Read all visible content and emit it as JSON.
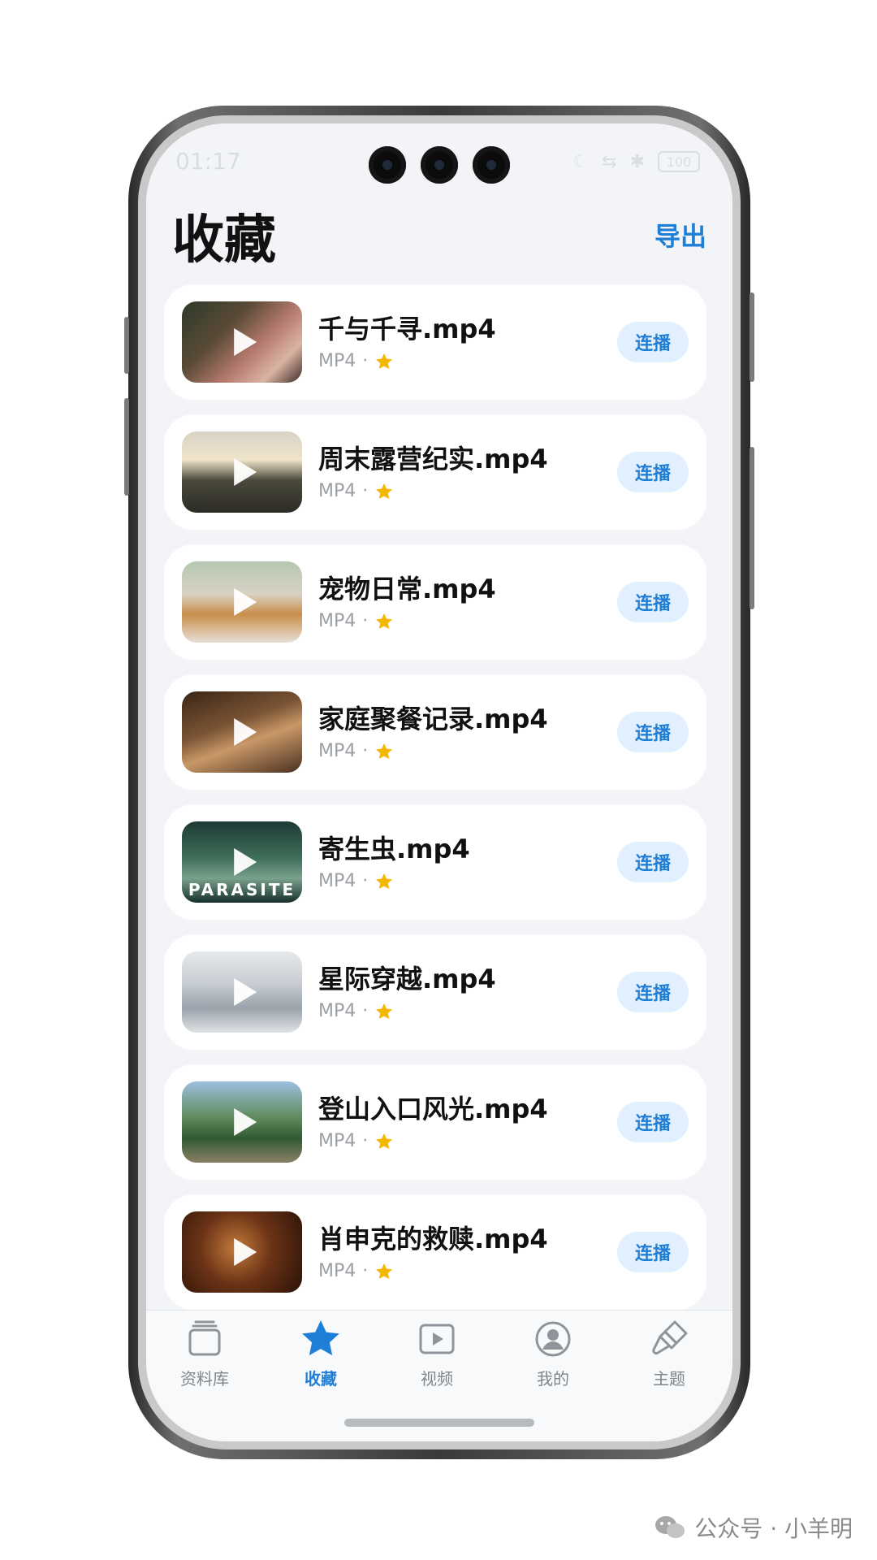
{
  "status_bar": {
    "time": "01:17",
    "battery": "100"
  },
  "header": {
    "title": "收藏",
    "export_label": "导出"
  },
  "items": [
    {
      "name": "千与千寻.mp4",
      "format": "MP4",
      "separator": "·",
      "play_label": "连播",
      "favorite": true,
      "thumb_overlay": ""
    },
    {
      "name": "周末露营纪实.mp4",
      "format": "MP4",
      "separator": "·",
      "play_label": "连播",
      "favorite": true,
      "thumb_overlay": ""
    },
    {
      "name": "宠物日常.mp4",
      "format": "MP4",
      "separator": "·",
      "play_label": "连播",
      "favorite": true,
      "thumb_overlay": ""
    },
    {
      "name": "家庭聚餐记录.mp4",
      "format": "MP4",
      "separator": "·",
      "play_label": "连播",
      "favorite": true,
      "thumb_overlay": ""
    },
    {
      "name": "寄生虫.mp4",
      "format": "MP4",
      "separator": "·",
      "play_label": "连播",
      "favorite": true,
      "thumb_overlay": "PARASITE"
    },
    {
      "name": "星际穿越.mp4",
      "format": "MP4",
      "separator": "·",
      "play_label": "连播",
      "favorite": true,
      "thumb_overlay": ""
    },
    {
      "name": "登山入口风光.mp4",
      "format": "MP4",
      "separator": "·",
      "play_label": "连播",
      "favorite": true,
      "thumb_overlay": ""
    },
    {
      "name": "肖申克的救赎.mp4",
      "format": "MP4",
      "separator": "·",
      "play_label": "连播",
      "favorite": true,
      "thumb_overlay": ""
    }
  ],
  "tabs": [
    {
      "label": "资料库",
      "icon": "library-icon",
      "active": false
    },
    {
      "label": "收藏",
      "icon": "star-icon",
      "active": true
    },
    {
      "label": "视频",
      "icon": "video-icon",
      "active": false
    },
    {
      "label": "我的",
      "icon": "profile-icon",
      "active": false
    },
    {
      "label": "主题",
      "icon": "brush-icon",
      "active": false
    }
  ],
  "watermark": {
    "text": "公众号 · 小羊明"
  },
  "colors": {
    "accent": "#1f7fd6",
    "star": "#f5b800",
    "chip_bg": "#e1efff"
  }
}
